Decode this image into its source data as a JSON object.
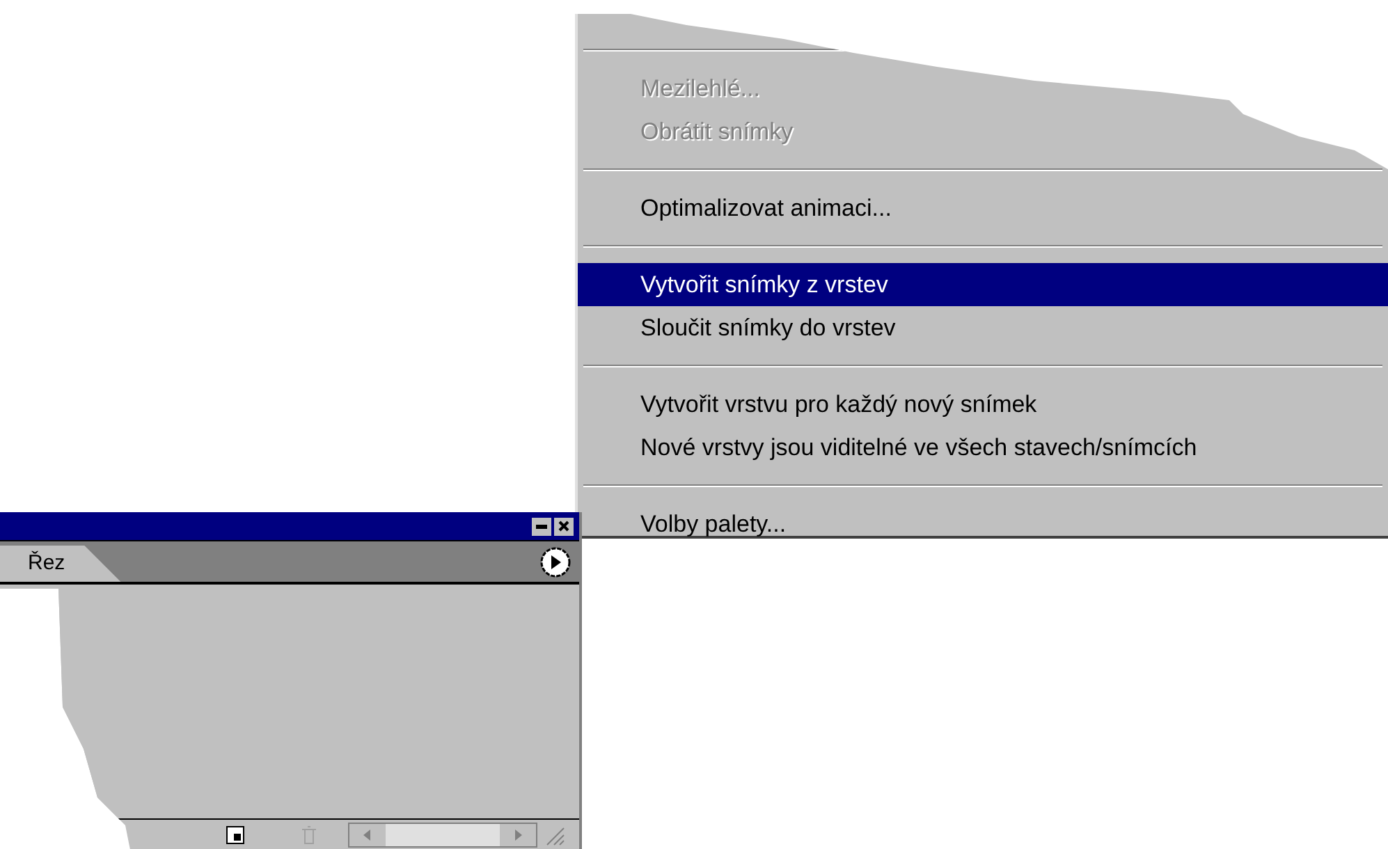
{
  "menu": {
    "items": [
      {
        "kind": "separator"
      },
      {
        "kind": "item",
        "label": "Mezilehlé...",
        "disabled": true,
        "selected": false
      },
      {
        "kind": "item",
        "label": "Obrátit snímky",
        "disabled": true,
        "selected": false
      },
      {
        "kind": "separator"
      },
      {
        "kind": "item",
        "label": "Optimalizovat animaci...",
        "disabled": false,
        "selected": false
      },
      {
        "kind": "separator"
      },
      {
        "kind": "item",
        "label": "Vytvořit snímky z vrstev",
        "disabled": false,
        "selected": true
      },
      {
        "kind": "item",
        "label": "Sloučit snímky do vrstev",
        "disabled": false,
        "selected": false
      },
      {
        "kind": "separator"
      },
      {
        "kind": "item",
        "label": "Vytvořit vrstvu pro každý nový snímek",
        "disabled": false,
        "selected": false
      },
      {
        "kind": "item",
        "label": "Nové vrstvy jsou viditelné ve všech stavech/snímcích",
        "disabled": false,
        "selected": false
      },
      {
        "kind": "separator"
      },
      {
        "kind": "item",
        "label": "Volby palety...",
        "disabled": false,
        "selected": false
      }
    ]
  },
  "panel": {
    "tabs": [
      {
        "label": "Řez",
        "selected": true
      }
    ]
  }
}
